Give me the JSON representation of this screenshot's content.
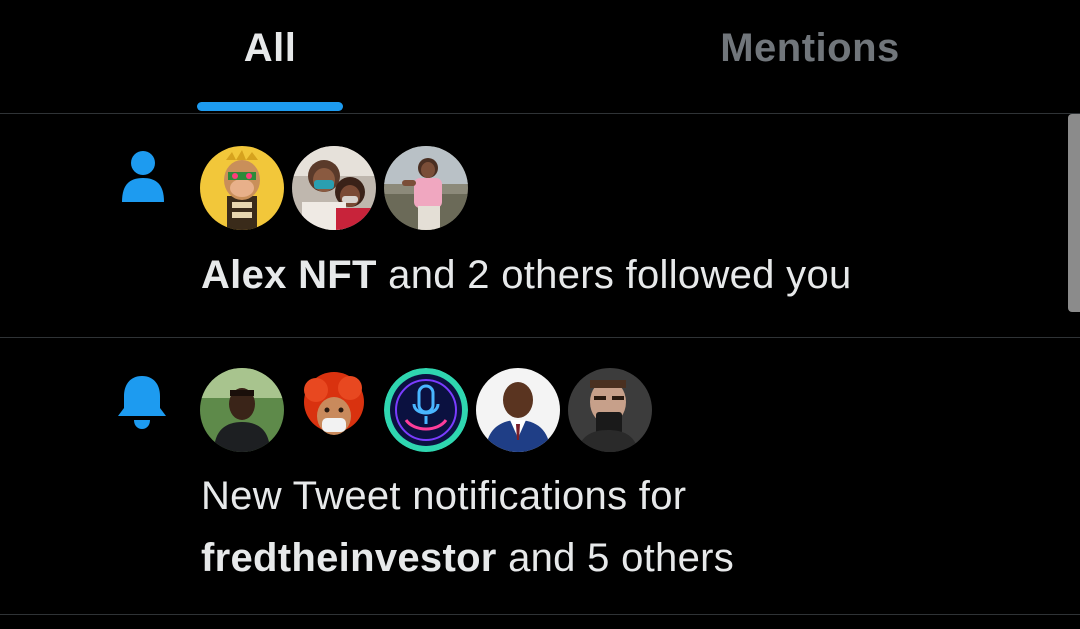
{
  "tabs": {
    "all_label": "All",
    "mentions_label": "Mentions",
    "active": "All"
  },
  "colors": {
    "accent": "#1d9bf0",
    "background": "#000000",
    "text_primary": "#e7e9ea",
    "text_secondary": "#71767b"
  },
  "notifications": [
    {
      "icon": "person-icon",
      "avatars": [
        "yellow-ape-nft-avatar",
        "two-girls-avatar",
        "woman-pink-shirt-avatar"
      ],
      "bold_name": "Alex NFT",
      "rest": " and 2 others followed you"
    },
    {
      "icon": "bell-icon",
      "avatars": [
        "man-outdoors-avatar",
        "red-afro-memoji-avatar",
        "podcast-mic-avatar",
        "man-suit-avatar",
        "man-drinking-mug-avatar"
      ],
      "line1": "New Tweet notifications for",
      "bold_name": "fredtheinvestor",
      "rest": " and 5 others"
    }
  ]
}
